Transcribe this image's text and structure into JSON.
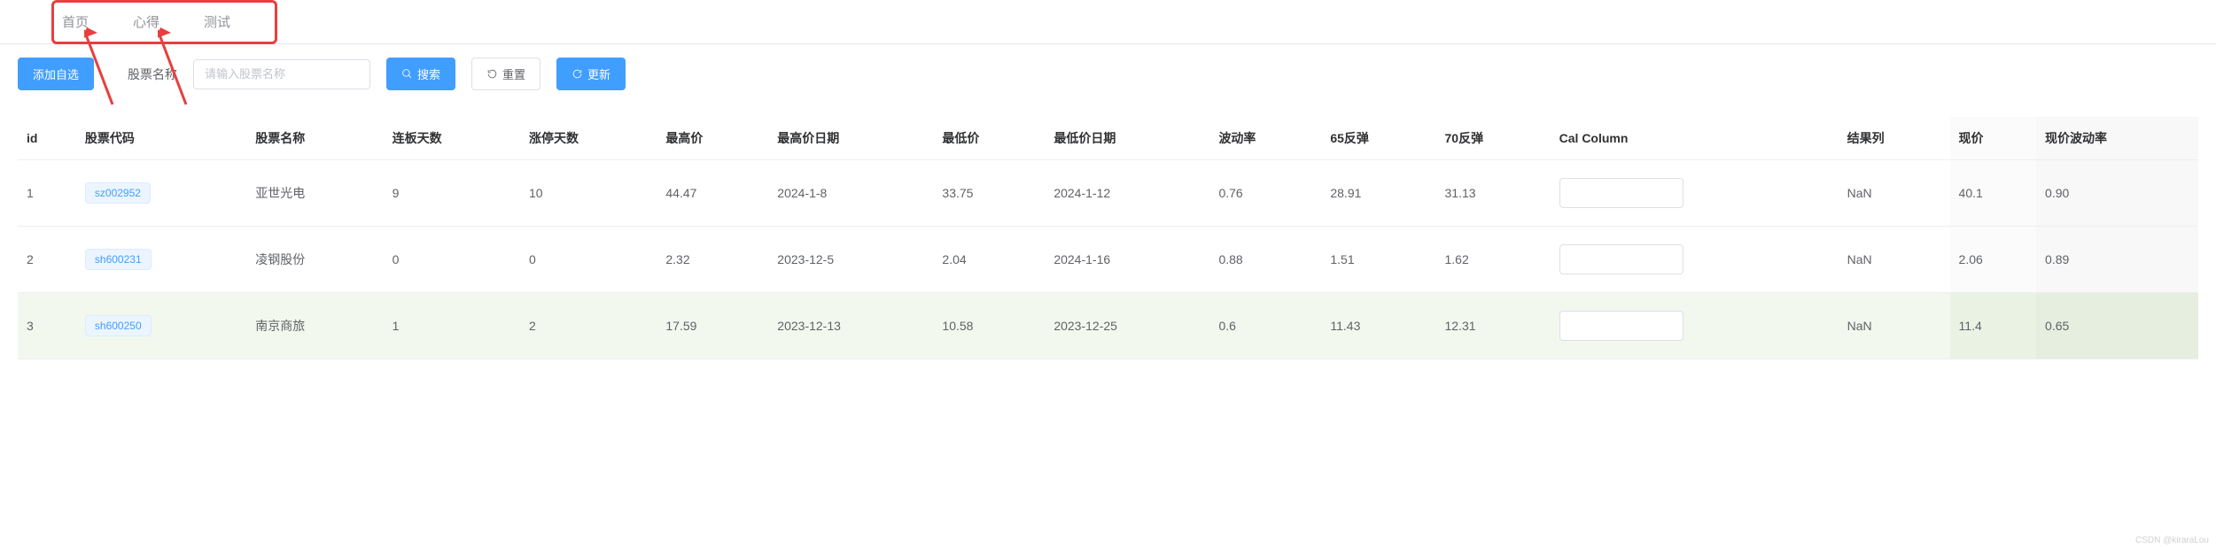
{
  "nav": {
    "items": [
      "首页",
      "心得",
      "测试"
    ]
  },
  "toolbar": {
    "add_button": "添加自选",
    "label": "股票名称",
    "placeholder": "请输入股票名称",
    "search_button": "搜索",
    "reset_button": "重置",
    "refresh_button": "更新"
  },
  "table": {
    "headers": [
      "id",
      "股票代码",
      "股票名称",
      "连板天数",
      "涨停天数",
      "最高价",
      "最高价日期",
      "最低价",
      "最低价日期",
      "波动率",
      "65反弹",
      "70反弹",
      "Cal Column",
      "结果列",
      "现价",
      "现价波动率"
    ],
    "rows": [
      {
        "id": "1",
        "code": "sz002952",
        "name": "亚世光电",
        "lianban": "9",
        "zhangting": "10",
        "maxp": "44.47",
        "maxd": "2024-1-8",
        "minp": "33.75",
        "mind": "2024-1-12",
        "vol": "0.76",
        "r65": "28.91",
        "r70": "31.13",
        "cal": "",
        "res": "NaN",
        "now": "40.1",
        "nowvol": "0.90"
      },
      {
        "id": "2",
        "code": "sh600231",
        "name": "凌钢股份",
        "lianban": "0",
        "zhangting": "0",
        "maxp": "2.32",
        "maxd": "2023-12-5",
        "minp": "2.04",
        "mind": "2024-1-16",
        "vol": "0.88",
        "r65": "1.51",
        "r70": "1.62",
        "cal": "",
        "res": "NaN",
        "now": "2.06",
        "nowvol": "0.89"
      },
      {
        "id": "3",
        "code": "sh600250",
        "name": "南京商旅",
        "lianban": "1",
        "zhangting": "2",
        "maxp": "17.59",
        "maxd": "2023-12-13",
        "minp": "10.58",
        "mind": "2023-12-25",
        "vol": "0.6",
        "r65": "11.43",
        "r70": "12.31",
        "cal": "",
        "res": "NaN",
        "now": "11.4",
        "nowvol": "0.65"
      }
    ]
  },
  "watermark": "CSDN @kiraraLou"
}
